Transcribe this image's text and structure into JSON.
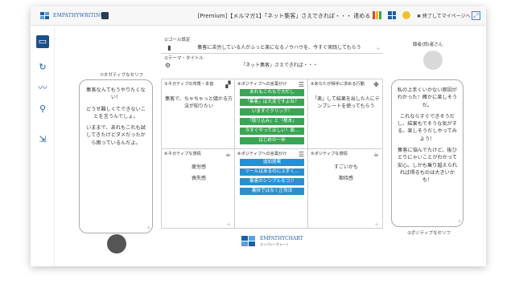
{
  "app": {
    "logo_text": "EMPATHYWRITING",
    "doc_title": "[Premium]【メルマガ1】「ネット集客」さえできれば・・・ 達める",
    "exit_label": "終了してマイページへ"
  },
  "goal": {
    "label": "①ゴール設定",
    "text": "集客に苦労している人がふっと楽になるノウハウを、今すぐ実践してもらう"
  },
  "theme": {
    "label": "②テーマ・タイトル",
    "text": "「ネット集客」さえできれば・・・"
  },
  "reader": {
    "label": "聴者(読)者さん",
    "negative_label": "⑦ネガティブなセリフ",
    "negative_lines": [
      "集客なんてもうやりたくない！",
      "どうせ難しくてできないことを言うんでしょ。",
      "いままで、あれもこれも試してきたけどダメだったから困っているんだよ。"
    ],
    "positive_label": "②ポジティブなセリフ",
    "positive_lines": [
      "私の上手くいかない原因がわかった！確かに楽しそうだ。",
      "これならすぐできそうだし、結果もでそうな気がする。楽しそうだしやってみよう！",
      "集客に悩んでたけど、後ひとりにゃいことがわかって安心。しかも乗り越えられれば得るものは大きいかも！"
    ]
  },
  "chart": {
    "cell3": {
      "label": "③ネガティブの背景・本音",
      "text": "集客で、ちゃちゃっと儲かる方法が知りたい"
    },
    "cell4": {
      "label": "④ポジティブへの言葉がけ",
      "tags": [
        "あれもこれもで大忙し",
        "「集客」は大変ですよね？",
        "いますぐクリック！",
        "「取り込み」と「根本」",
        "今すぐやってほしい！面...",
        "はじめの一歩"
      ]
    },
    "cell5": {
      "label": "④あなたが相手に求める行動",
      "text": "「楽」して結果を出した人にテンプレートを使ってもらう"
    },
    "cell6": {
      "label": "⑥ネガティブな感情",
      "words": [
        "疲労感",
        "喪失感"
      ]
    },
    "cell7": {
      "label": "⑥ポジティブへの言葉がけ",
      "tags": [
        "追加提案",
        "ツールはあるのに上手く...",
        "集客のシンプルなコツ",
        "裏技ではなく正攻法"
      ]
    },
    "cell8": {
      "label": "⑤ポジティブな感情",
      "words": [
        "すごいかも",
        "期待感"
      ]
    }
  },
  "footer": {
    "logo_main": "EMPATHYCHART",
    "logo_sub": "エンパシーチャート"
  },
  "colors": {
    "accent": "#1b5fa8",
    "tag_green": "#3aa655",
    "tag_blue": "#2b8fcf"
  }
}
